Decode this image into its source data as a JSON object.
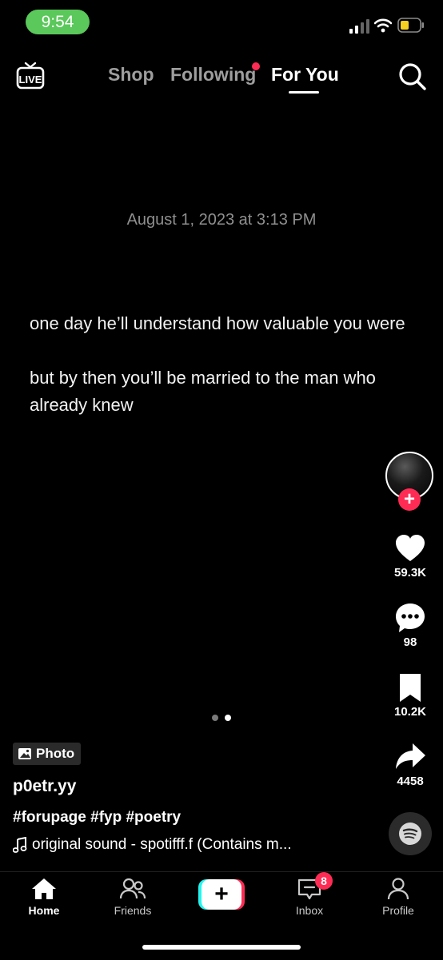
{
  "status_bar": {
    "time": "9:54",
    "time_pill_color": "#5ac85a"
  },
  "top_nav": {
    "tabs": [
      {
        "label": "Shop",
        "active": false
      },
      {
        "label": "Following",
        "active": false,
        "has_dot": true
      },
      {
        "label": "For You",
        "active": true
      }
    ],
    "live_label": "LIVE"
  },
  "post": {
    "date": "August 1, 2023 at 3:13 PM",
    "paragraphs": [
      "one day he’ll understand how valuable you were",
      "but by then you’ll be married to the man who already knew"
    ],
    "current_photo": 2,
    "total_photos": 2
  },
  "actions": {
    "likes": "59.3K",
    "comments": "98",
    "saves": "10.2K",
    "shares": "4458"
  },
  "info": {
    "badge": "Photo",
    "username": "p0etr.yy",
    "hashtags": "#forupage #fyp #poetry",
    "sound": "original sound - spotifff.f (Contains m..."
  },
  "tabbar": {
    "home": "Home",
    "friends": "Friends",
    "inbox": "Inbox",
    "inbox_badge": "8",
    "profile": "Profile"
  },
  "colors": {
    "accent": "#fe2c55",
    "cyan": "#25f4ee",
    "background": "#000000"
  }
}
